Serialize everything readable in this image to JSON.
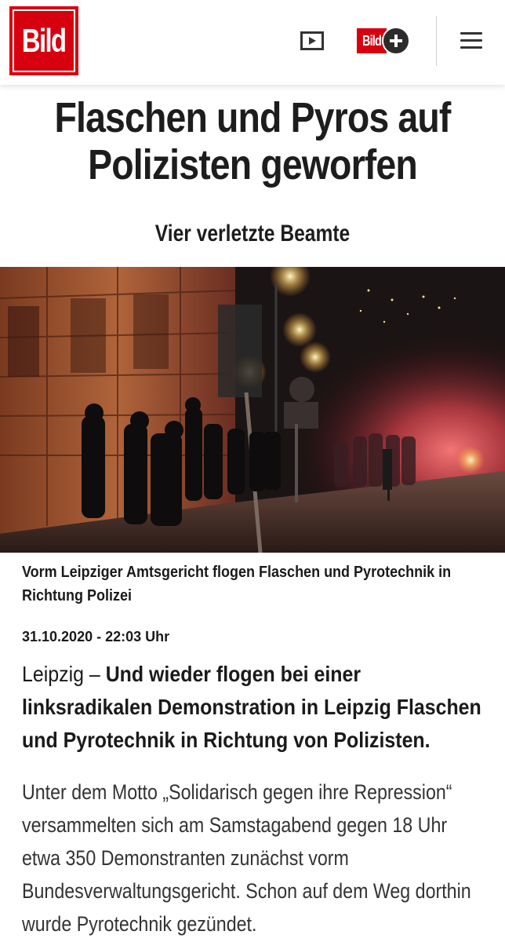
{
  "header": {
    "logo_text": "Bild",
    "bildplus_text": "Bild",
    "icons": [
      "play-video-icon",
      "plus-icon",
      "hamburger-menu-icon"
    ]
  },
  "article": {
    "headline": "Flaschen und Pyros auf\nPolizisten geworfen",
    "subline": "Vier verletzte Beamte",
    "caption": "Vorm Leipziger Amtsgericht flogen Flaschen und Pyrotechnik in Richtung Polizei",
    "date": "31.10.2020 - 22:03 Uhr",
    "lead_place": "Leipzig – ",
    "lead_text": "Und wieder flogen bei einer linksradikalen Demonstration in Leipzig Flaschen und Pyrotechnik in Richtung von Polizisten.",
    "body": "Unter dem Motto „Solidarisch gegen ihre Repression“ versammelten sich am Samstagabend gegen 18 Uhr etwa 350 Demonstranten zunächst vorm Bundesverwaltungsgericht. Schon auf dem Weg dorthin wurde Pyrotechnik gezündet."
  },
  "colors": {
    "brand_red": "#d7000f",
    "text_dark": "#1a1a1a"
  }
}
